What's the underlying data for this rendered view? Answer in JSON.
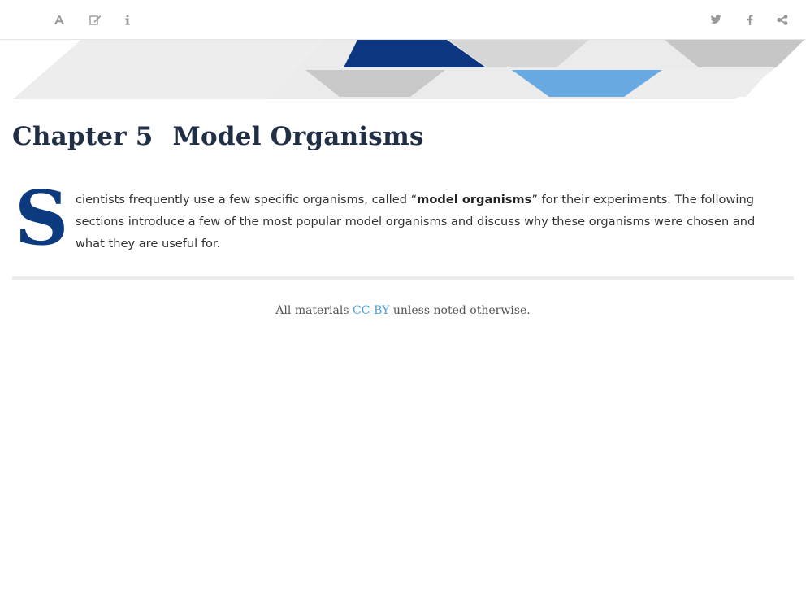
{
  "toolbar": {
    "left_icons": [
      "font-icon",
      "edit-icon",
      "info-icon"
    ],
    "right_icons": [
      "twitter-icon",
      "facebook-icon",
      "share-icon"
    ],
    "icon_color": "#999999"
  },
  "banner": {
    "colors": {
      "navy": "#0d3680",
      "sky": "#68a9e2",
      "gray": "#c4c4c4",
      "light_gray": "#e8e8e8"
    }
  },
  "chapter": {
    "number": "Chapter 5",
    "title": "Model Organisms",
    "title_color": "#202e46"
  },
  "intro": {
    "drop_cap": "S",
    "drop_cap_color": "#0b3a7e",
    "text_before": "cientists frequently use a few specific organisms, called “",
    "bold_term": "model organisms",
    "text_after": "” for their experiments. The following sections introduce a few of the most popular model organisms and discuss why these organisms were chosen and what they are useful for."
  },
  "footer": {
    "prefix": "All materials ",
    "license_link": "CC-BY",
    "suffix": " unless noted otherwise.",
    "link_color": "#4a9fd8"
  }
}
